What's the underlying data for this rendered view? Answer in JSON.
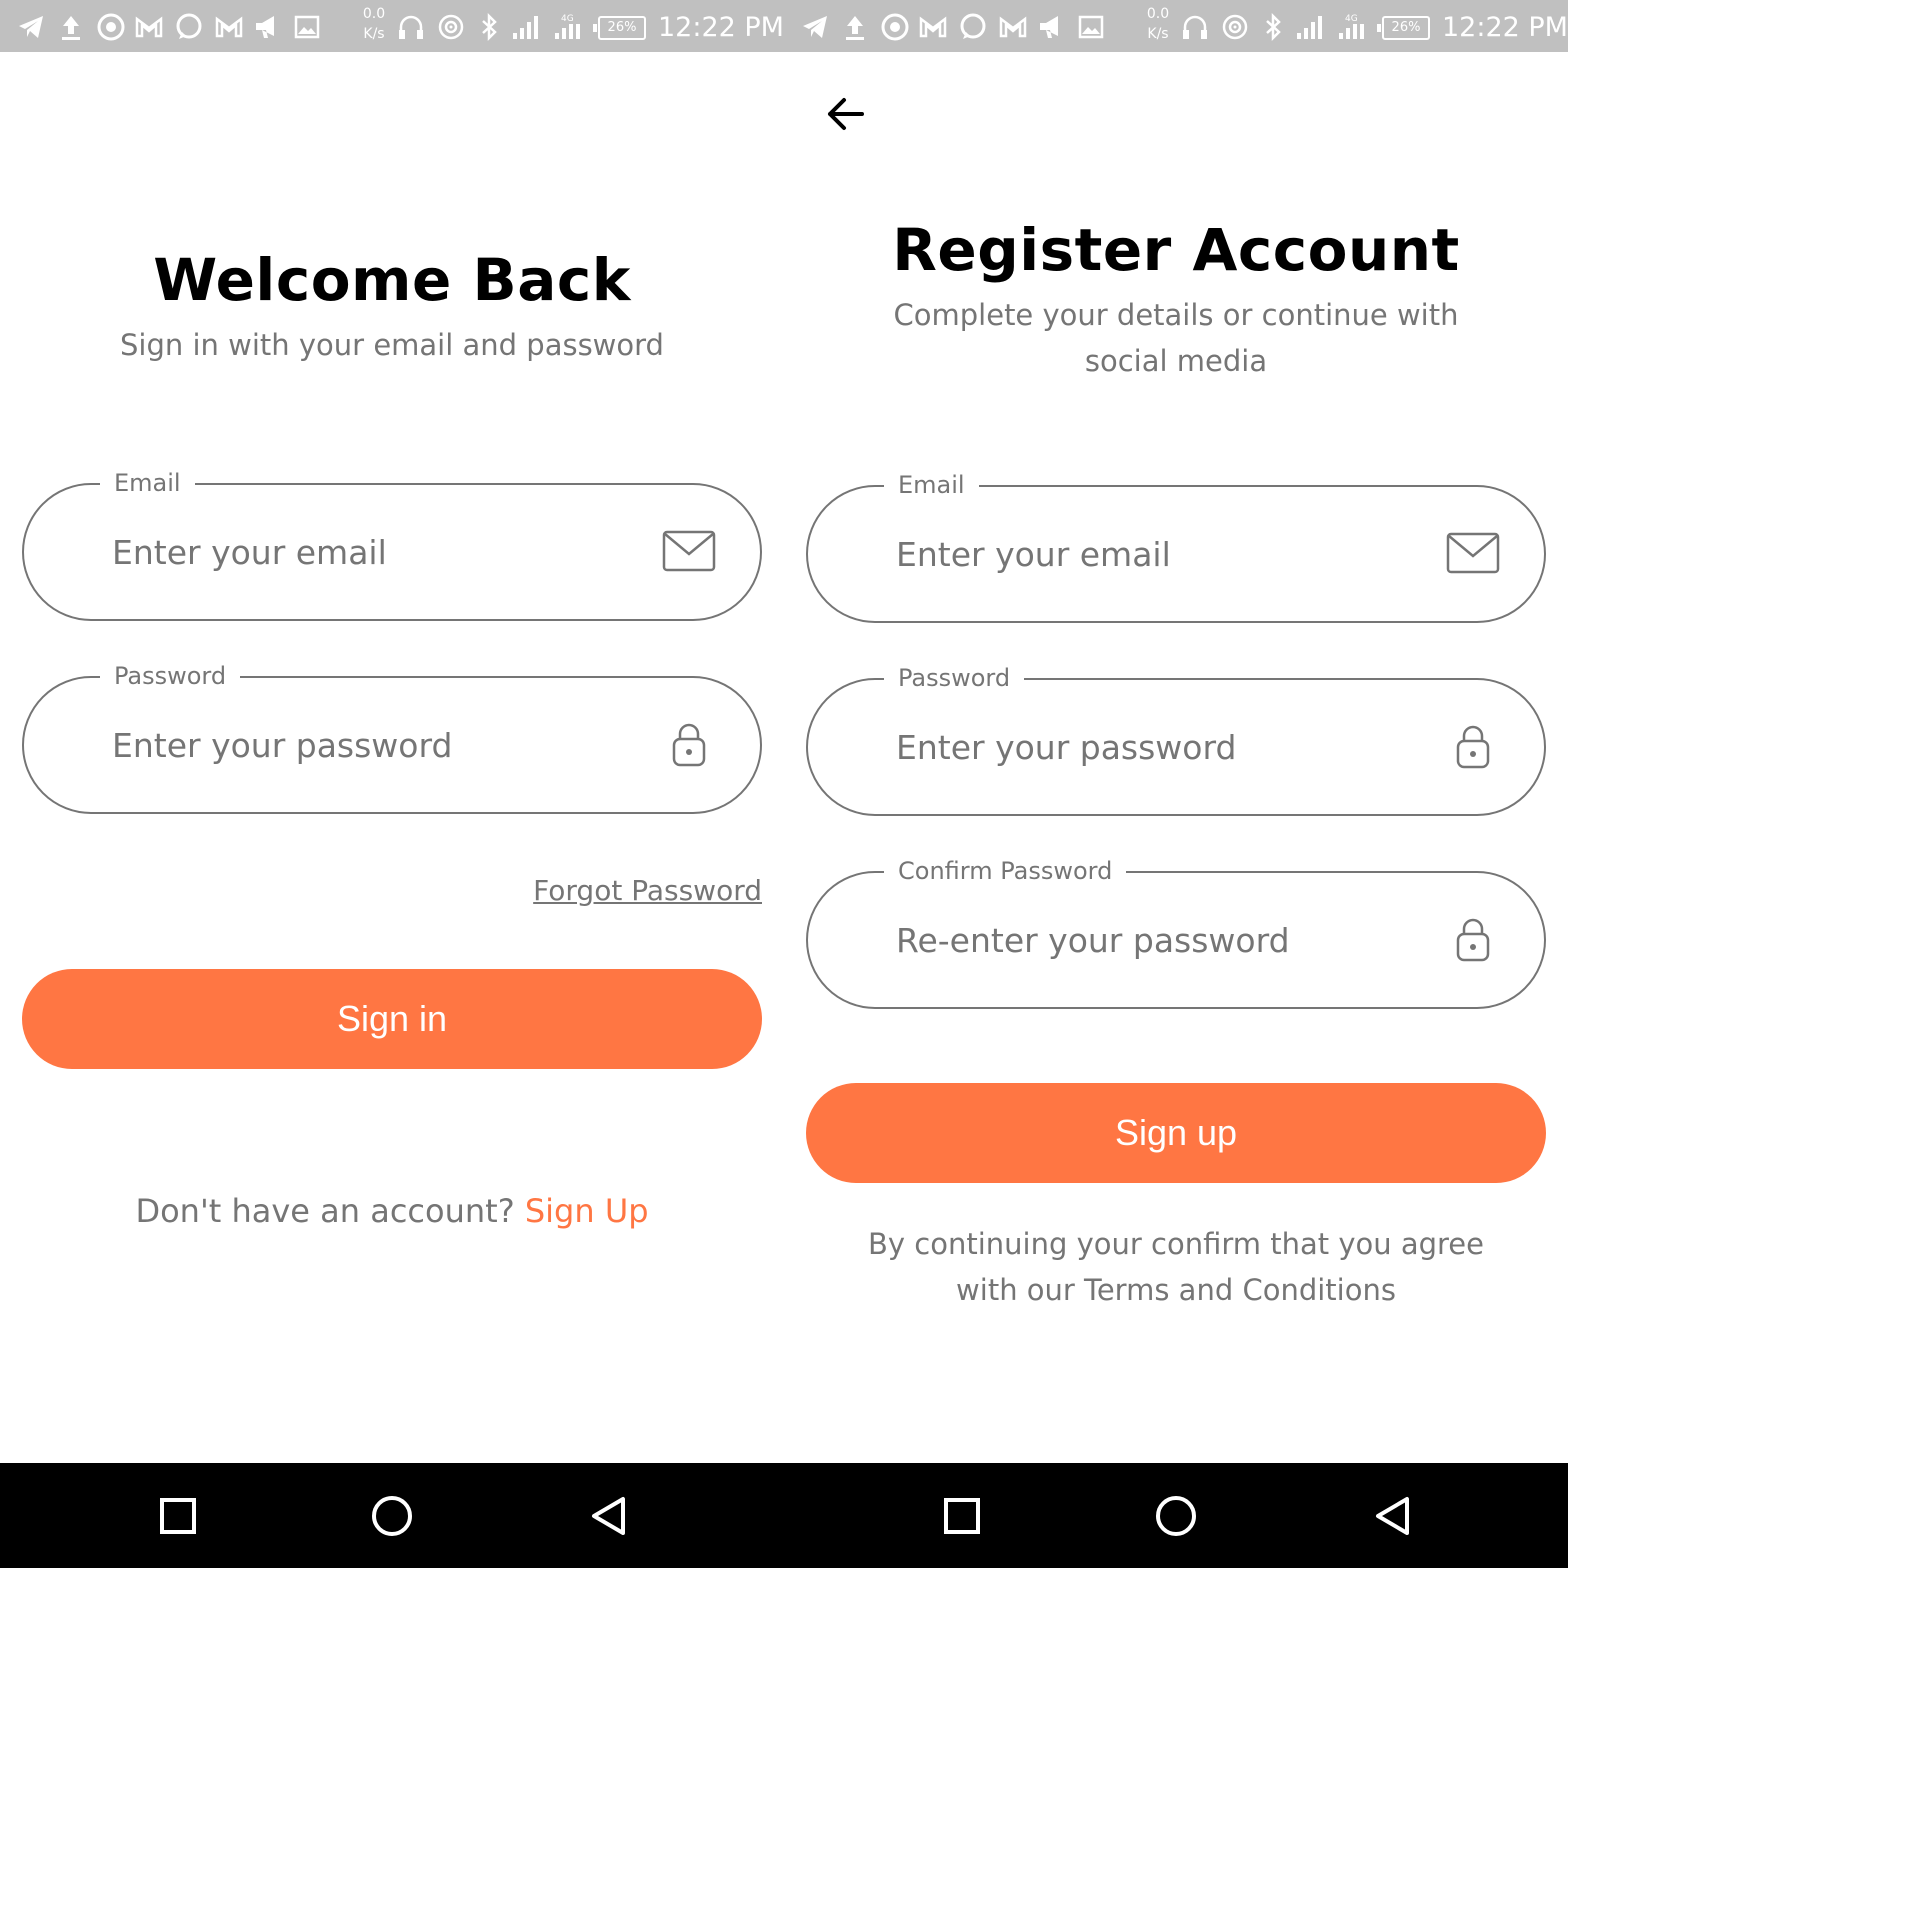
{
  "status_bar": {
    "speed_value": "0.0",
    "speed_unit": "K/s",
    "network_label": "4G",
    "battery": "26%",
    "time": "12:22 PM",
    "icons": [
      "telegram-icon",
      "upload-icon",
      "chrome-icon",
      "gmail-icon",
      "whatsapp-icon",
      "gmail-icon",
      "megaphone-icon",
      "image-icon",
      "headphones-icon",
      "hotspot-icon",
      "bluetooth-icon",
      "signal-icon",
      "signal-4g-icon"
    ],
    "color": "#c0c0c0"
  },
  "sign_in": {
    "title": "Welcome Back",
    "subtitle": "Sign in with your email and password",
    "email": {
      "label": "Email",
      "placeholder": "Enter your email",
      "value": ""
    },
    "password": {
      "label": "Password",
      "placeholder": "Enter your password",
      "value": ""
    },
    "forgot_password": "Forgot Password",
    "sign_in_button": "Sign in",
    "no_account_text": "Don't have an account?",
    "sign_up_link": "Sign Up"
  },
  "register": {
    "title": "Register Account",
    "subtitle": "Complete your details or continue with social media",
    "email": {
      "label": "Email",
      "placeholder": "Enter your email",
      "value": ""
    },
    "password": {
      "label": "Password",
      "placeholder": "Enter your password",
      "value": ""
    },
    "confirm_password": {
      "label": "Confirm Password",
      "placeholder": "Re-enter your password",
      "value": ""
    },
    "sign_up_button": "Sign up",
    "terms_text": "By continuing your confirm that you agree with our Terms and Conditions"
  },
  "colors": {
    "accent": "#ff7643",
    "text_muted": "#757575",
    "title": "#000000"
  },
  "nav_icons": [
    "recents-square-icon",
    "home-circle-icon",
    "back-triangle-icon"
  ]
}
